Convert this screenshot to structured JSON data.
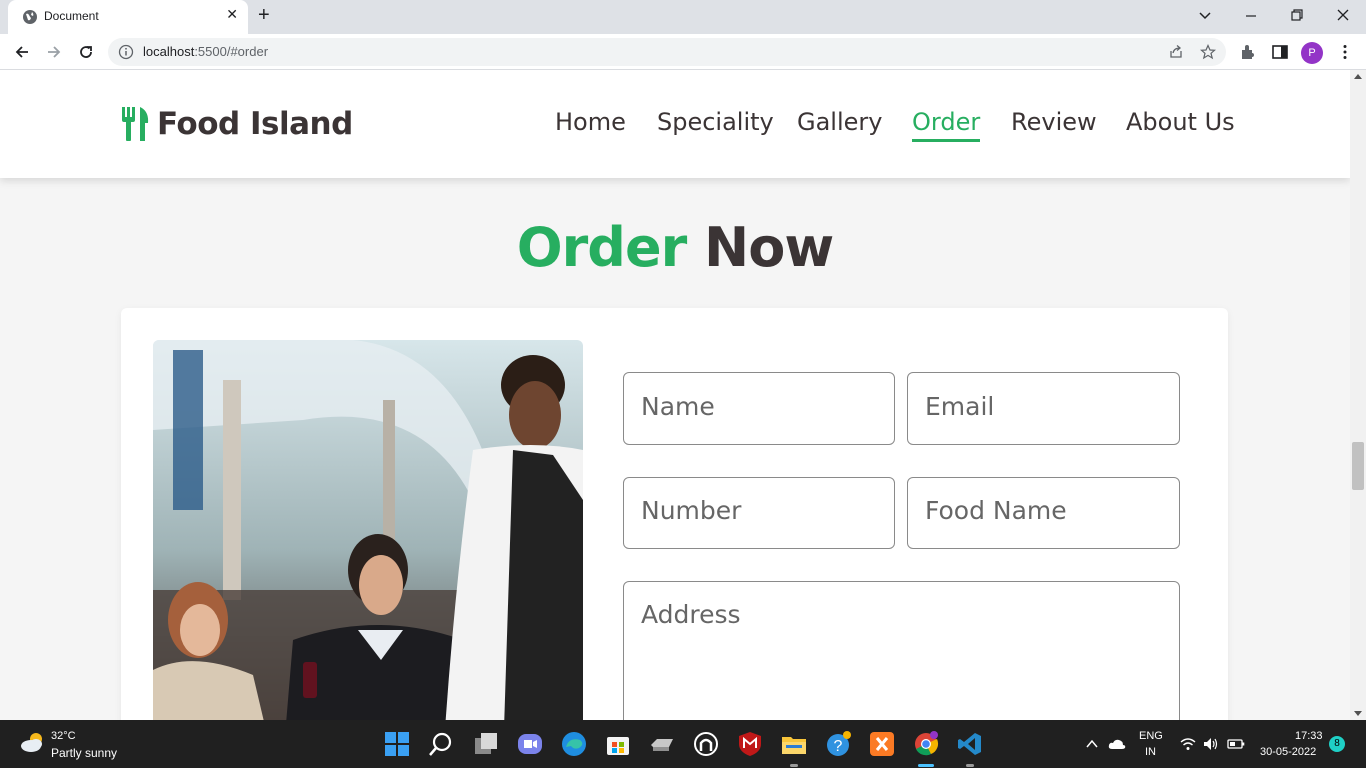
{
  "browser": {
    "tab_title": "Document",
    "url_host": "localhost",
    "url_rest": ":5500/#order",
    "profile_initial": "P"
  },
  "site": {
    "logo_text": "Food Island",
    "nav": [
      {
        "label": "Home",
        "active": false
      },
      {
        "label": "Speciality",
        "active": false
      },
      {
        "label": "Gallery",
        "active": false
      },
      {
        "label": "Order",
        "active": true
      },
      {
        "label": "Review",
        "active": false
      },
      {
        "label": "About Us",
        "active": false
      }
    ],
    "accent_color": "#27ae60",
    "text_color": "#3b3435"
  },
  "order": {
    "heading_accent": "Order",
    "heading_rest": "Now",
    "fields": {
      "name_placeholder": "Name",
      "email_placeholder": "Email",
      "number_placeholder": "Number",
      "food_name_placeholder": "Food Name",
      "address_placeholder": "Address"
    }
  },
  "taskbar": {
    "weather_temp": "32°C",
    "weather_desc": "Partly sunny",
    "lang_top": "ENG",
    "lang_bottom": "IN",
    "time": "17:33",
    "date": "30-05-2022",
    "notification_count": "8"
  }
}
